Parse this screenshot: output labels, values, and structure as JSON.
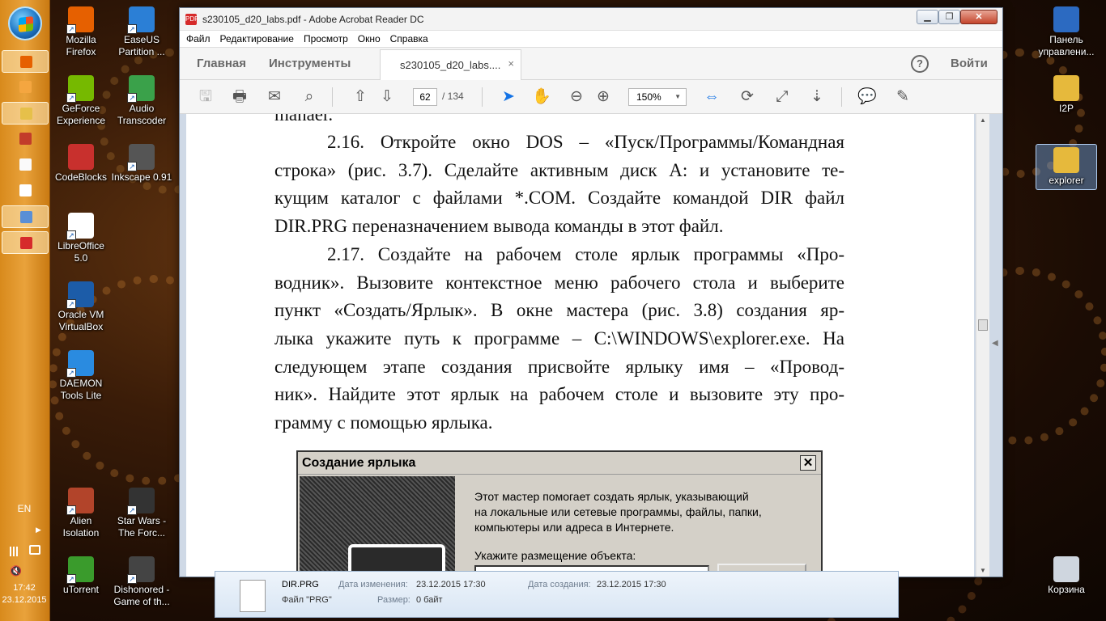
{
  "desktop": {
    "icons_col1": [
      {
        "label": "Mozilla\nFirefox",
        "color": "#e66000",
        "shortcut": true
      },
      {
        "label": "GeForce\nExperience",
        "color": "#76b900",
        "shortcut": true
      },
      {
        "label": "CodeBlocks",
        "color": "#c8302d",
        "shortcut": false
      },
      {
        "label": "LibreOffice\n5.0",
        "color": "#ffffff",
        "shortcut": true
      },
      {
        "label": "Oracle VM\nVirtualBox",
        "color": "#1c5ca8",
        "shortcut": true
      },
      {
        "label": "DAEMON\nTools Lite",
        "color": "#2a8be0",
        "shortcut": true
      },
      {
        "label": "Alien\nIsolation",
        "color": "#b2442a",
        "shortcut": true
      },
      {
        "label": "uTorrent",
        "color": "#3a9b2c",
        "shortcut": true
      }
    ],
    "icons_col2": [
      {
        "label": "EaseUS\nPartition ...",
        "color": "#2b7fd6",
        "shortcut": true
      },
      {
        "label": "Audio\nTranscoder",
        "color": "#3aa14a",
        "shortcut": true
      },
      {
        "label": "Inkscape 0.91",
        "color": "#555555",
        "shortcut": true
      },
      {
        "label": "Star Wars -\nThe Forc...",
        "color": "#333333",
        "shortcut": true
      },
      {
        "label": "Dishonored -\nGame of th...",
        "color": "#444444",
        "shortcut": true
      }
    ],
    "icons_right": [
      {
        "label": "Панель\nуправлени...",
        "color": "#2c6ac1"
      },
      {
        "label": "I2P",
        "color": "#e6b93c"
      },
      {
        "label": "explorer",
        "color": "#e6b93c"
      },
      {
        "label": "Корзина",
        "color": "#cfd6df"
      }
    ]
  },
  "taskbar": {
    "language": "EN",
    "time": "17:42",
    "date": "23.12.2015",
    "buttons": [
      {
        "name": "firefox",
        "color": "#e66000",
        "active": true
      },
      {
        "name": "app-moon",
        "color": "#f4a640",
        "active": false
      },
      {
        "name": "explorer",
        "color": "#e6c04a",
        "active": true
      },
      {
        "name": "colorful-app",
        "color": "#c23c2a",
        "active": false
      },
      {
        "name": "calendar-app",
        "color": "#fafafa",
        "active": false
      },
      {
        "name": "document",
        "color": "#ffffff",
        "active": false
      },
      {
        "name": "notes",
        "color": "#5a8fd6",
        "active": true
      },
      {
        "name": "acrobat",
        "color": "#d62b2b",
        "active": true
      }
    ]
  },
  "window": {
    "title": "s230105_d20_labs.pdf - Adobe Acrobat Reader DC",
    "pdf_icon": "PDF",
    "minimize": "▁",
    "maximize": "❐",
    "close": "✕",
    "menu": [
      "Файл",
      "Редактирование",
      "Просмотр",
      "Окно",
      "Справка"
    ],
    "nav_home": "Главная",
    "nav_tools": "Инструменты",
    "doc_tab": "s230105_d20_labs....",
    "doc_tab_close": "×",
    "help": "?",
    "signin": "Войти",
    "page_current": "62",
    "page_total": "/ 134",
    "zoom": "150%",
    "zoom_dropdown": "▼"
  },
  "document": {
    "top_cut": "manaer.",
    "lines": [
      {
        "text": "2.16. Откройте окно DOS – «Пуск/Программы/Командная",
        "indent": true,
        "justify": true
      },
      {
        "text": "строка» (рис. 3.7). Сделайте активным диск A: и установите те-",
        "indent": false,
        "justify": true
      },
      {
        "text": "кущим каталог с файлами *.COM. Создайте командой DIR файл",
        "indent": false,
        "justify": true
      },
      {
        "text": "DIR.PRG переназначением вывода команды в этот файл.",
        "indent": false,
        "justify": false
      },
      {
        "text": "2.17. Создайте на рабочем столе ярлык программы «Про-",
        "indent": true,
        "justify": true
      },
      {
        "text": "водник». Вызовите контекстное меню рабочего стола и выберите",
        "indent": false,
        "justify": true
      },
      {
        "text": "пункт «Создать/Ярлык». В окне мастера (рис. 3.8) создания яр-",
        "indent": false,
        "justify": true
      },
      {
        "text": "лыка укажите путь к программе – C:\\WINDOWS\\explorer.exe. На",
        "indent": false,
        "justify": true
      },
      {
        "text": "следующем этапе создания присвойте ярлыку имя – «Провод-",
        "indent": false,
        "justify": true
      },
      {
        "text": "ник». Найдите этот ярлык на рабочем столе и вызовите эту про-",
        "indent": false,
        "justify": true
      },
      {
        "text": "грамму с помощью ярлыка.",
        "indent": false,
        "justify": false
      }
    ],
    "dialog": {
      "title": "Создание ярлыка",
      "close": "✕",
      "text_lines": [
        "Этот мастер помогает создать ярлык, указывающий",
        "на локальные или сетевые программы, файлы, папки,",
        "компьютеры или адреса в Интернете."
      ],
      "location_label": "Укажите размещение объекта:"
    }
  },
  "details_pane": {
    "filename": "DIR.PRG",
    "filetype": "Файл \"PRG\"",
    "modified_label": "Дата изменения:",
    "modified_value": "23.12.2015 17:30",
    "size_label": "Размер:",
    "size_value": "0 байт",
    "created_label": "Дата создания:",
    "created_value": "23.12.2015 17:30"
  }
}
